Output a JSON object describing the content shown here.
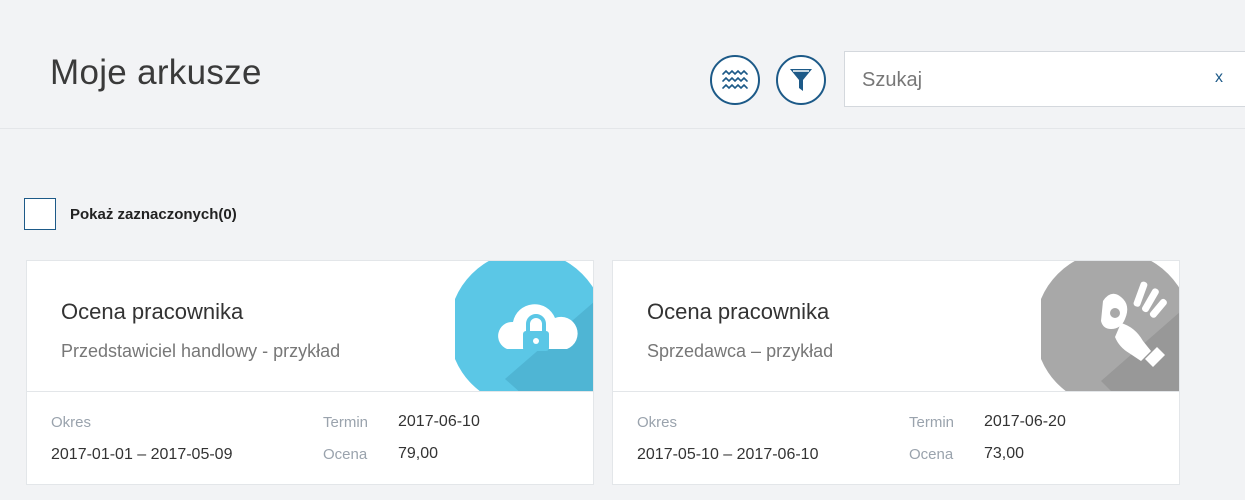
{
  "header": {
    "title": "Moje arkusze",
    "search": {
      "placeholder": "Szukaj",
      "value": "",
      "clear_label": "x"
    },
    "sort_icon": "sort-lines-icon",
    "filter_icon": "funnel-icon"
  },
  "filter": {
    "show_selected_label": "Pokaż zaznaczonych(0)",
    "checked": false
  },
  "colors": {
    "accent": "#1d5a88",
    "card1_image_bg": "#5bc7e6",
    "card2_image_bg": "#a8a8a8"
  },
  "cards": [
    {
      "title": "Ocena pracownika",
      "subtitle": "Przedstawiciel handlowy - przykład",
      "image_icon": "cloud-lock-icon",
      "period_label": "Okres",
      "period_value": "2017-01-01 – 2017-05-09",
      "term_label": "Termin",
      "term_value": "2017-06-10",
      "score_label": "Ocena",
      "score_value": "79,00"
    },
    {
      "title": "Ocena pracownika",
      "subtitle": "Sprzedawca – przykład",
      "image_icon": "ok-hand-icon",
      "period_label": "Okres",
      "period_value": "2017-05-10 – 2017-06-10",
      "term_label": "Termin",
      "term_value": "2017-06-20",
      "score_label": "Ocena",
      "score_value": "73,00"
    }
  ]
}
